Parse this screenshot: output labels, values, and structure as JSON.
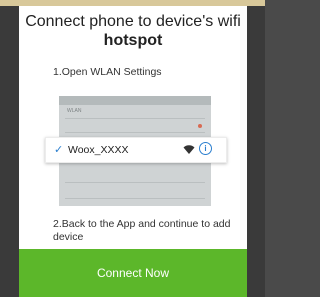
{
  "dialog": {
    "title_line1": "Connect phone to device's wifi",
    "title_line2": "hotspot",
    "step1": "1.Open WLAN Settings",
    "step2": "2.Back to the App and continue to add device",
    "button_label": "Connect Now"
  },
  "illustration": {
    "wlan_header": "WLAN",
    "network_name": "Woox_XXXX",
    "check_glyph": "✓",
    "info_glyph": "i"
  },
  "colors": {
    "primary_button": "#5cb72a",
    "accent_blue": "#2b7fcf"
  }
}
